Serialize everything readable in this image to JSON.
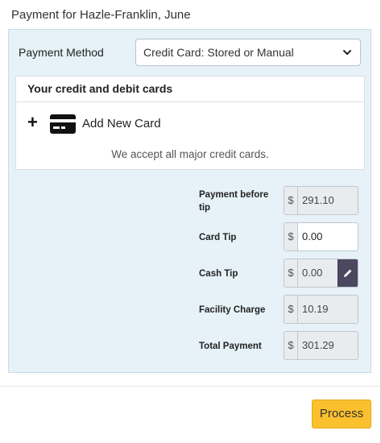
{
  "dialog": {
    "title": "Payment for Hazle-Franklin, June"
  },
  "payment_method": {
    "label": "Payment Method",
    "selected": "Credit Card: Stored or Manual"
  },
  "cards": {
    "heading": "Your credit and debit cards",
    "add_label": "Add New Card",
    "accept_note": "We accept all major credit cards."
  },
  "summary": {
    "currency_symbol": "$",
    "rows": [
      {
        "label": "Payment before tip",
        "value": "291.10"
      },
      {
        "label": "Card Tip",
        "value": "0.00"
      },
      {
        "label": "Cash Tip",
        "value": "0.00"
      },
      {
        "label": "Facility Charge",
        "value": "10.19"
      },
      {
        "label": "Total Payment",
        "value": "301.29"
      }
    ]
  },
  "footer": {
    "process_label": "Process"
  },
  "colors": {
    "panel_bg": "#e6f1f8",
    "process_button": "#fbc02d",
    "edit_button": "#4b4860"
  },
  "icons": [
    "chevron-down-icon",
    "plus-icon",
    "credit-card-icon",
    "pencil-icon"
  ]
}
